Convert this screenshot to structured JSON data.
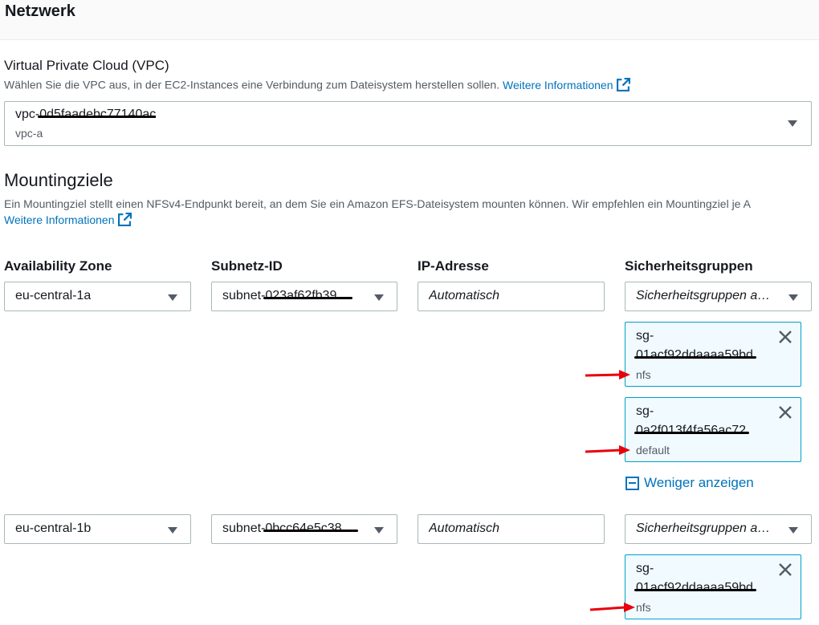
{
  "section": {
    "title": "Netzwerk"
  },
  "vpc": {
    "label": "Virtual Private Cloud (VPC)",
    "description": "Wählen Sie die VPC aus, in der EC2-Instances eine Verbindung zum Dateisystem herstellen sollen.",
    "more_info": "Weitere Informationen",
    "value_prefix": "vpc-",
    "value_redacted": "0d5faadebc77140ac",
    "value_sub": "vpc-a"
  },
  "mount_targets": {
    "title": "Mountingziele",
    "description": "Ein Mountingziel stellt einen NFSv4-Endpunkt bereit, an dem Sie ein Amazon EFS-Dateisystem mounten können. Wir empfehlen ein Mountingziel je A",
    "more_info": "Weitere Informationen",
    "columns": {
      "az": "Availability Zone",
      "subnet": "Subnetz-ID",
      "ip": "IP-Adresse",
      "sg": "Sicherheitsgruppen"
    },
    "ip_placeholder": "Automatisch",
    "sg_placeholder": "Sicherheitsgruppen a…",
    "show_less": "Weniger anzeigen",
    "rows": [
      {
        "az": "eu-central-1a",
        "subnet_prefix": "subnet-",
        "subnet_redacted": "023af62fb39…",
        "groups": [
          {
            "prefix": "sg-",
            "id_redacted": "01acf92ddaaaa59bd",
            "name": "nfs"
          },
          {
            "prefix": "sg-",
            "id_redacted": "0a2f013f4fa56ac72",
            "name": "default"
          }
        ]
      },
      {
        "az": "eu-central-1b",
        "subnet_prefix": "subnet-",
        "subnet_redacted": "0bcc64e5c38…",
        "groups": [
          {
            "prefix": "sg-",
            "id_redacted": "01acf92ddaaaa59bd",
            "name": "nfs"
          }
        ]
      }
    ]
  },
  "colors": {
    "link": "#0073bb",
    "token_bg": "#f1faff",
    "token_border": "#00a1c9",
    "annotation_arrow": "#e8000b"
  },
  "icons": {
    "external_link": "external-link-icon",
    "dropdown": "caret-down-icon",
    "remove": "close-icon",
    "collapse": "minus-square-icon"
  }
}
